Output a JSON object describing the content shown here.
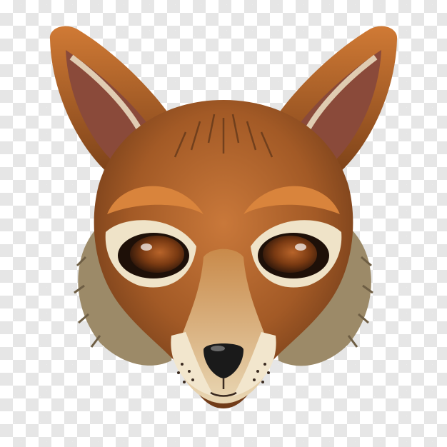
{
  "image": {
    "subject": "fox-mask",
    "background": "transparency-checkerboard",
    "colors": {
      "checker_light": "#ffffff",
      "checker_dark": "#e6e6e6",
      "fur_orange": "#b8642a",
      "fur_dark": "#5a3318",
      "cream": "#efe3c8",
      "ear_inner": "#8a4a3a",
      "eye_amber": "#7a3a12",
      "nose_black": "#1a1a1a",
      "ruff_tan": "#9c8a68"
    }
  }
}
